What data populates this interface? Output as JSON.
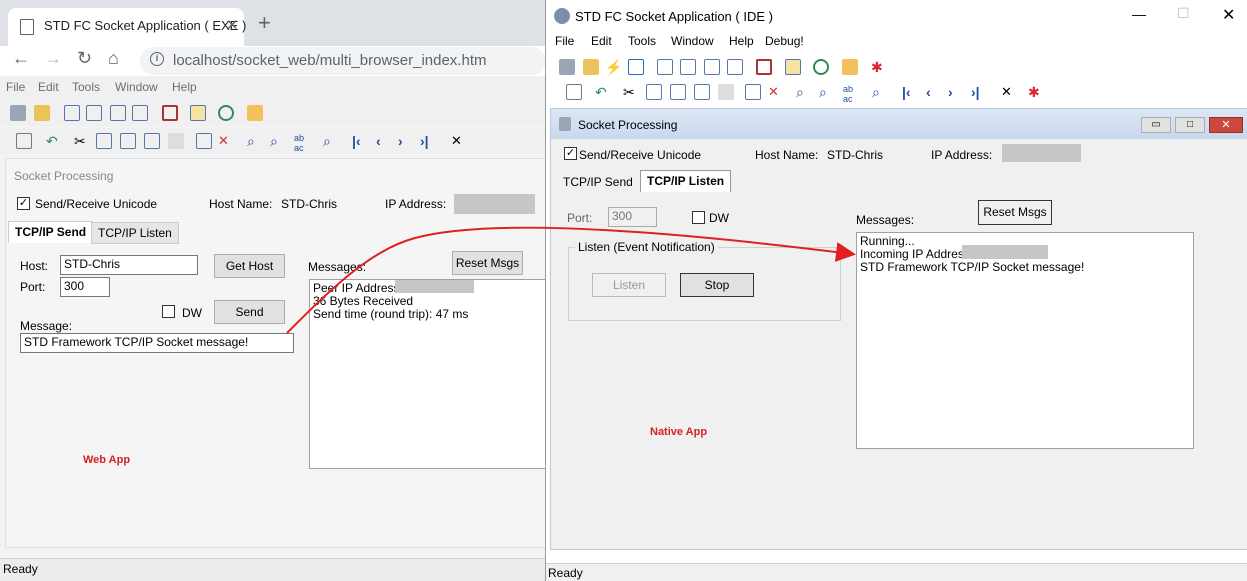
{
  "web": {
    "tab_title": "STD FC Socket Application ( EXE )",
    "url": "localhost/socket_web/multi_browser_index.htm",
    "menu": [
      "File",
      "Edit",
      "Tools",
      "Window",
      "Help"
    ],
    "panel_title": "Socket Processing",
    "unicode_label": "Send/Receive Unicode",
    "host_name_label": "Host Name:",
    "host_name_value": "STD-Chris",
    "ip_label": "IP Address:",
    "tabs": [
      "TCP/IP Send",
      "TCP/IP Listen"
    ],
    "host_label": "Host:",
    "host_value": "STD-Chris",
    "get_host": "Get Host",
    "port_label": "Port:",
    "port_value": "300",
    "dw_label": "DW",
    "send": "Send",
    "message_label": "Message:",
    "message_value": "STD Framework TCP/IP Socket message!",
    "messages_label": "Messages:",
    "reset": "Reset Msgs",
    "messages": [
      "Peer IP Address:",
      "36 Bytes Received",
      "Send time (round trip): 47 ms"
    ],
    "caption": "Web App",
    "status": "Ready"
  },
  "native": {
    "title": "STD FC Socket Application ( IDE )",
    "menu": [
      "File",
      "Edit",
      "Tools",
      "Window",
      "Help",
      "Debug!"
    ],
    "panel_title": "Socket Processing",
    "unicode_label": "Send/Receive Unicode",
    "host_name_label": "Host Name:",
    "host_name_value": "STD-Chris",
    "ip_label": "IP Address:",
    "tabs": [
      "TCP/IP Send",
      "TCP/IP Listen"
    ],
    "port_label": "Port:",
    "port_value": "300",
    "dw_label": "DW",
    "messages_label": "Messages:",
    "reset": "Reset Msgs",
    "group_label": "Listen (Event Notification)",
    "listen": "Listen",
    "stop": "Stop",
    "messages": [
      "Running...",
      "Incoming IP Address:",
      "STD Framework TCP/IP Socket message!"
    ],
    "caption": "Native App",
    "status": "Ready"
  },
  "colors": {
    "caption": "#d42020",
    "arrow": "#e02020",
    "tab_active": "#ffffff"
  }
}
